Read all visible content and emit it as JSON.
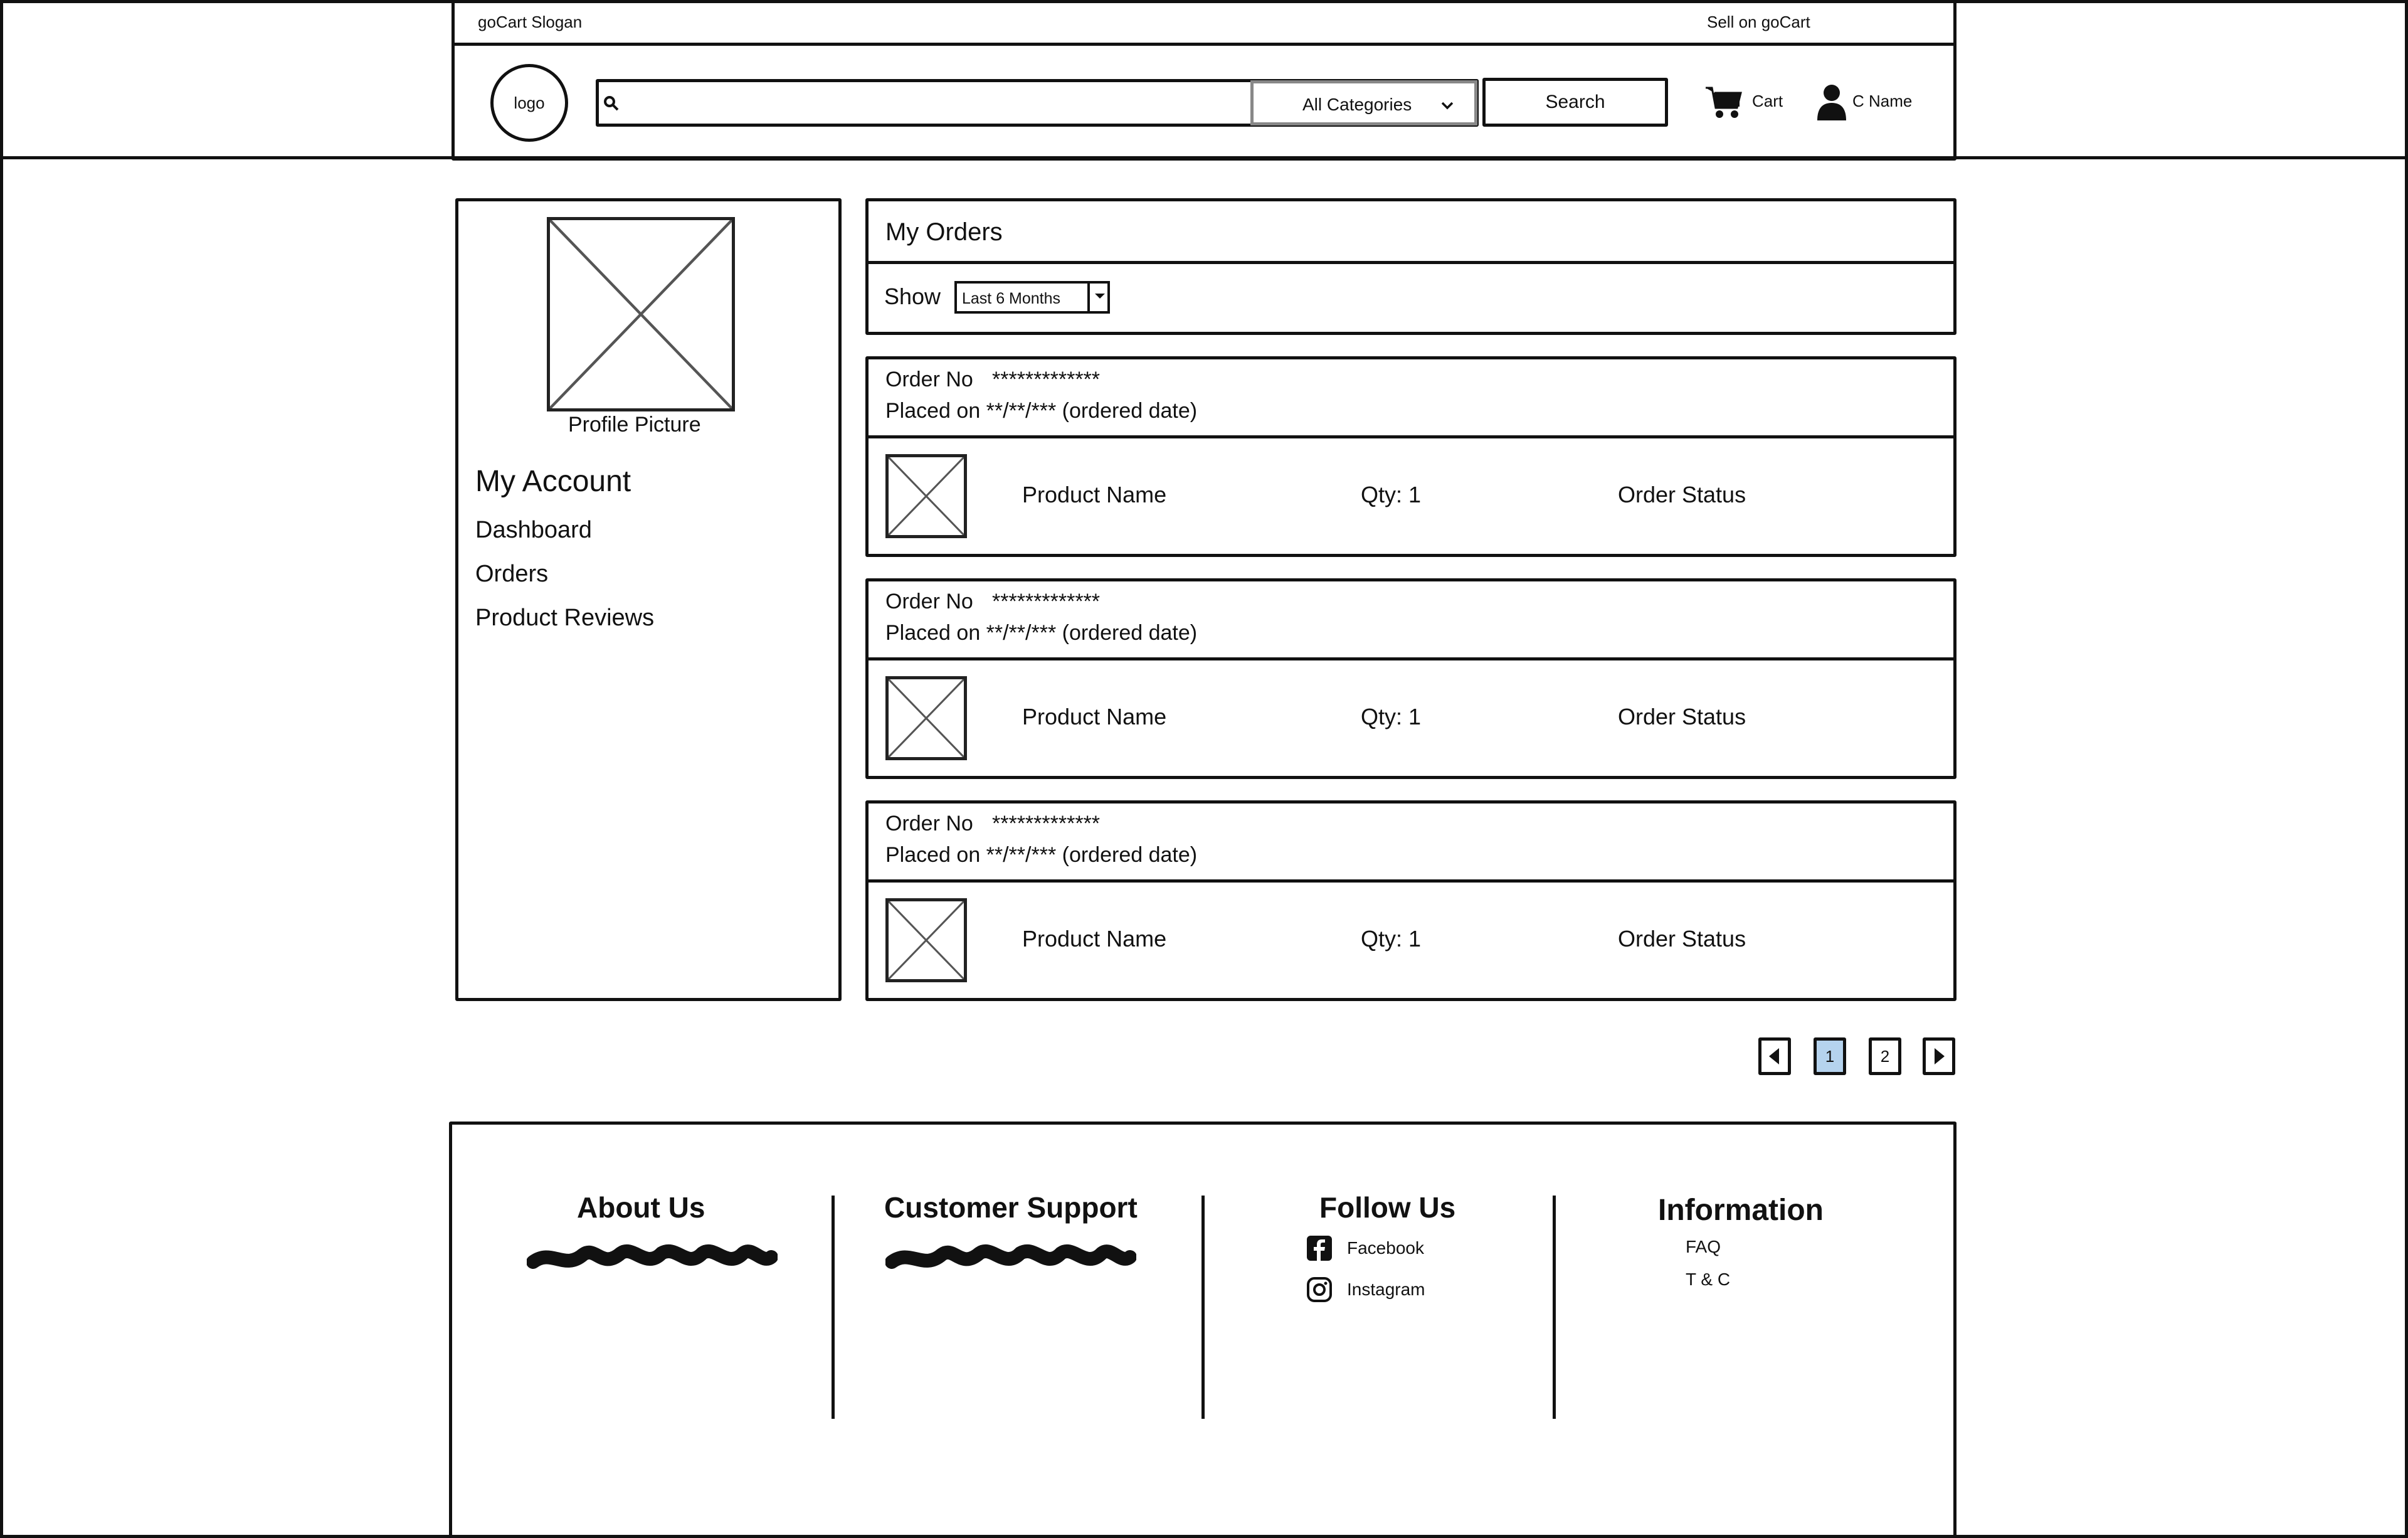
{
  "topbar": {
    "slogan": "goCart Slogan",
    "sell": "Sell on goCart"
  },
  "header": {
    "logo": "logo",
    "search_placeholder": "",
    "category_selected": "All Categories",
    "search_button": "Search",
    "cart_label": "Cart",
    "user_name": "C Name"
  },
  "sidebar": {
    "profile_caption": "Profile Picture",
    "heading": "My Account",
    "items": [
      "Dashboard",
      "Orders",
      "Product Reviews"
    ]
  },
  "orders_panel": {
    "title": "My Orders",
    "show_label": "Show",
    "filter_selected": "Last 6 Months"
  },
  "orders": [
    {
      "order_no_label": "Order No",
      "order_no": "*************",
      "placed_on": "Placed on **/**/*** (ordered date)",
      "product_name": "Product Name",
      "qty": "Qty: 1",
      "status": "Order Status"
    },
    {
      "order_no_label": "Order No",
      "order_no": "*************",
      "placed_on": "Placed on **/**/*** (ordered date)",
      "product_name": "Product Name",
      "qty": "Qty: 1",
      "status": "Order Status"
    },
    {
      "order_no_label": "Order No",
      "order_no": "*************",
      "placed_on": "Placed on **/**/*** (ordered date)",
      "product_name": "Product Name",
      "qty": "Qty: 1",
      "status": "Order Status"
    }
  ],
  "pagination": {
    "pages": [
      "1",
      "2"
    ],
    "current": "1"
  },
  "footer": {
    "about_title": "About Us",
    "support_title": "Customer Support",
    "follow_title": "Follow Us",
    "social": [
      "Facebook",
      "Instagram"
    ],
    "info_title": "Information",
    "info_links": [
      "FAQ",
      "T & C"
    ]
  },
  "icons": {
    "search": "search-icon",
    "dropdown": "chevron-down-icon",
    "cart": "cart-icon",
    "user": "user-icon",
    "facebook": "facebook-icon",
    "instagram": "instagram-icon",
    "prev": "prev-page-icon",
    "next": "next-page-icon"
  },
  "colors": {
    "current_page_bg": "#b5d3ee"
  }
}
